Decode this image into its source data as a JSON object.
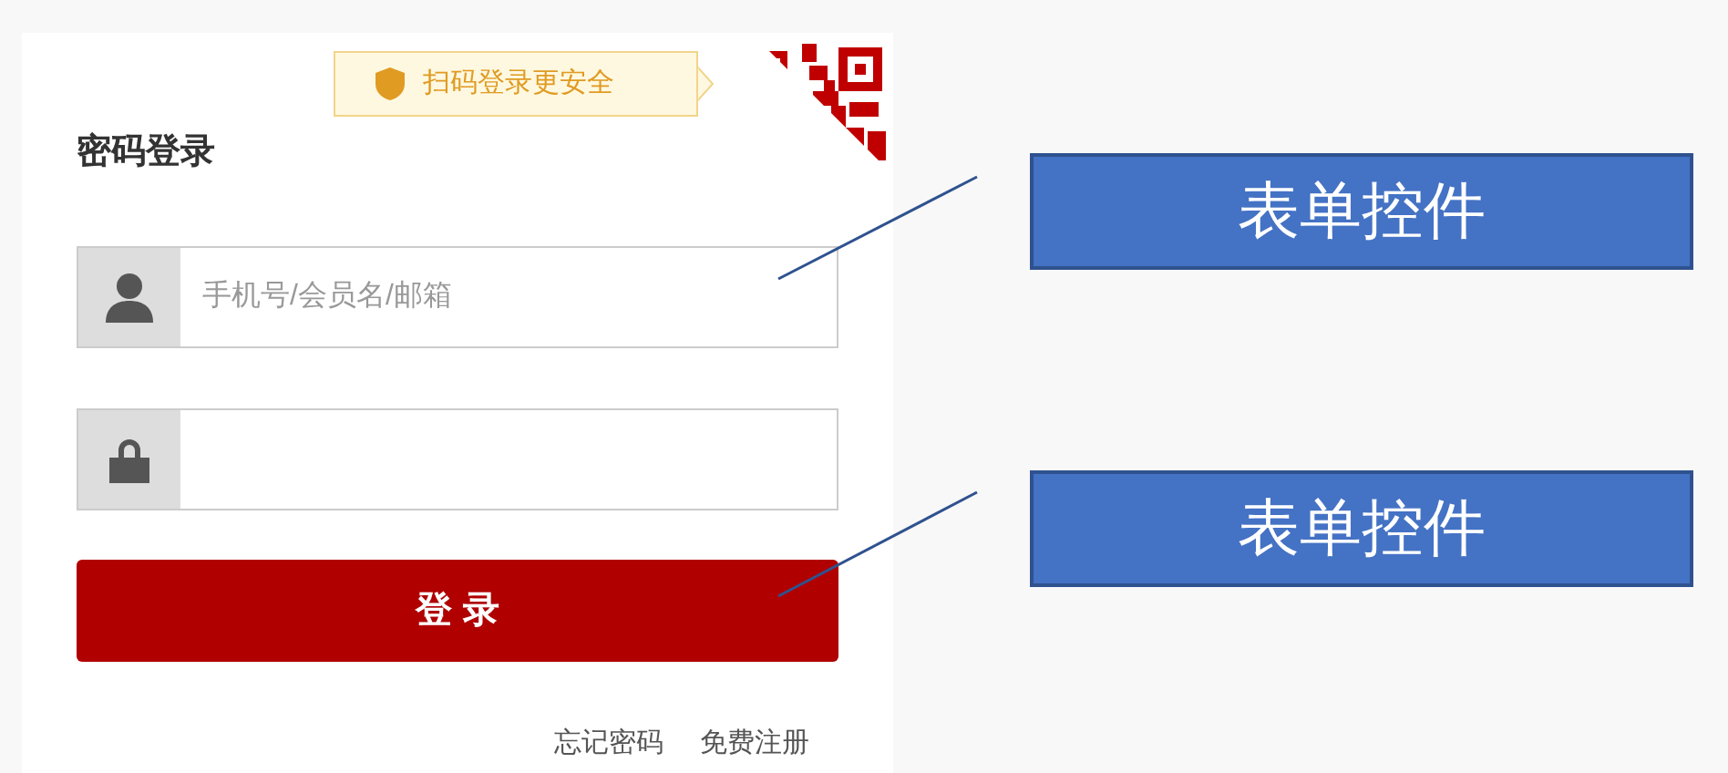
{
  "login": {
    "scan_tip": "扫码登录更安全",
    "title": "密码登录",
    "username": {
      "placeholder": "手机号/会员名/邮箱"
    },
    "submit": "登 录",
    "links": [
      "忘记密码",
      "免费注册"
    ]
  },
  "callouts": [
    {
      "label": "表单控件"
    },
    {
      "label": "表单控件"
    }
  ]
}
